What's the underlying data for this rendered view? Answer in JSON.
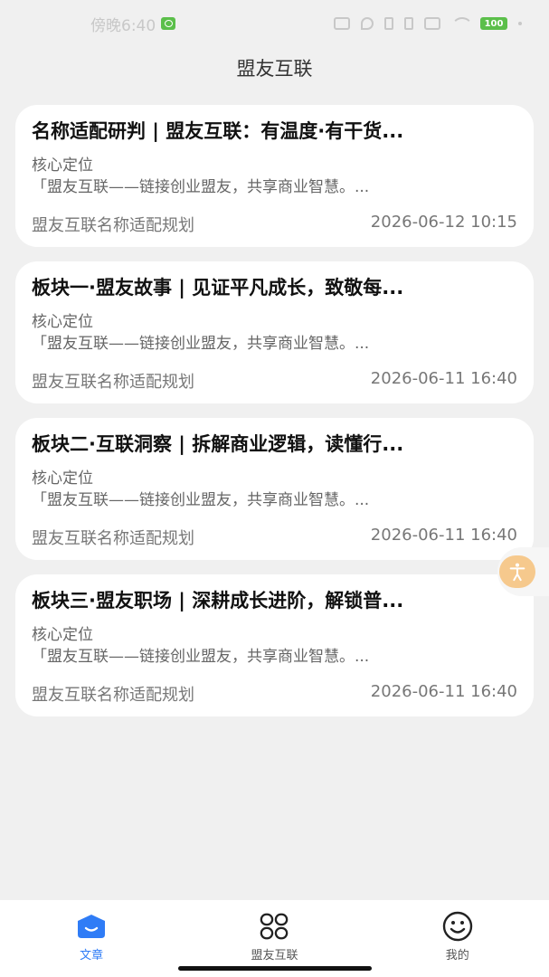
{
  "status_bar": {
    "time": "傍晚6:40",
    "battery": "100"
  },
  "header": {
    "title": "盟友互联"
  },
  "articles": [
    {
      "title": "名称适配研判 | 盟友互联：有温度·有干货...",
      "subhead": "核心定位",
      "summary": "「盟友互联——链接创业盟友，共享商业智慧。...",
      "source": "盟友互联名称适配规划",
      "date": "2026-06-12 10:15"
    },
    {
      "title": "板块一·盟友故事 | 见证平凡成长，致敬每...",
      "subhead": "核心定位",
      "summary": "「盟友互联——链接创业盟友，共享商业智慧。...",
      "source": "盟友互联名称适配规划",
      "date": "2026-06-11 16:40"
    },
    {
      "title": "板块二·互联洞察 | 拆解商业逻辑，读懂行...",
      "subhead": "核心定位",
      "summary": "「盟友互联——链接创业盟友，共享商业智慧。...",
      "source": "盟友互联名称适配规划",
      "date": "2026-06-11 16:40"
    },
    {
      "title": "板块三·盟友职场 | 深耕成长进阶，解锁普...",
      "subhead": "核心定位",
      "summary": "「盟友互联——链接创业盟友，共享商业智慧。...",
      "source": "盟友互联名称适配规划",
      "date": "2026-06-11 16:40"
    }
  ],
  "bottom_nav": [
    {
      "label": "文章",
      "icon": "article-icon",
      "active": true
    },
    {
      "label": "盟友互联",
      "icon": "grid-icon",
      "active": false
    },
    {
      "label": "我的",
      "icon": "smiley-icon",
      "active": false
    }
  ],
  "colors": {
    "accent": "#2f7cf6",
    "background": "#f0f0f0",
    "card": "#ffffff",
    "float_button": "#f6c98d"
  }
}
